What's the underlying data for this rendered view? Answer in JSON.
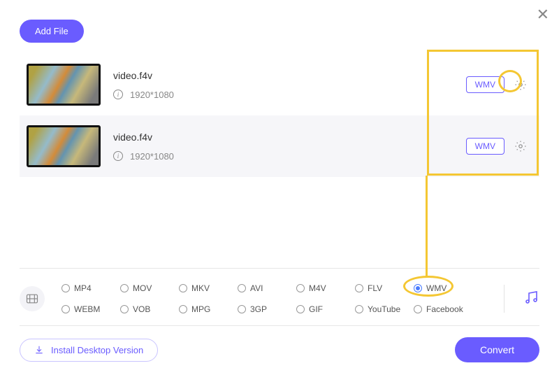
{
  "header": {
    "add_file": "Add File"
  },
  "files": [
    {
      "name": "video.f4v",
      "resolution": "1920*1080",
      "format": "WMV"
    },
    {
      "name": "video.f4v",
      "resolution": "1920*1080",
      "format": "WMV"
    }
  ],
  "formats": {
    "row1": [
      "MP4",
      "MOV",
      "MKV",
      "AVI",
      "M4V",
      "FLV"
    ],
    "row2": [
      "WEBM",
      "VOB",
      "MPG",
      "3GP",
      "GIF",
      "YouTube"
    ],
    "extra1": "WMV",
    "extra2": "Facebook",
    "selected": "WMV"
  },
  "footer": {
    "install": "Install Desktop Version",
    "convert": "Convert"
  }
}
